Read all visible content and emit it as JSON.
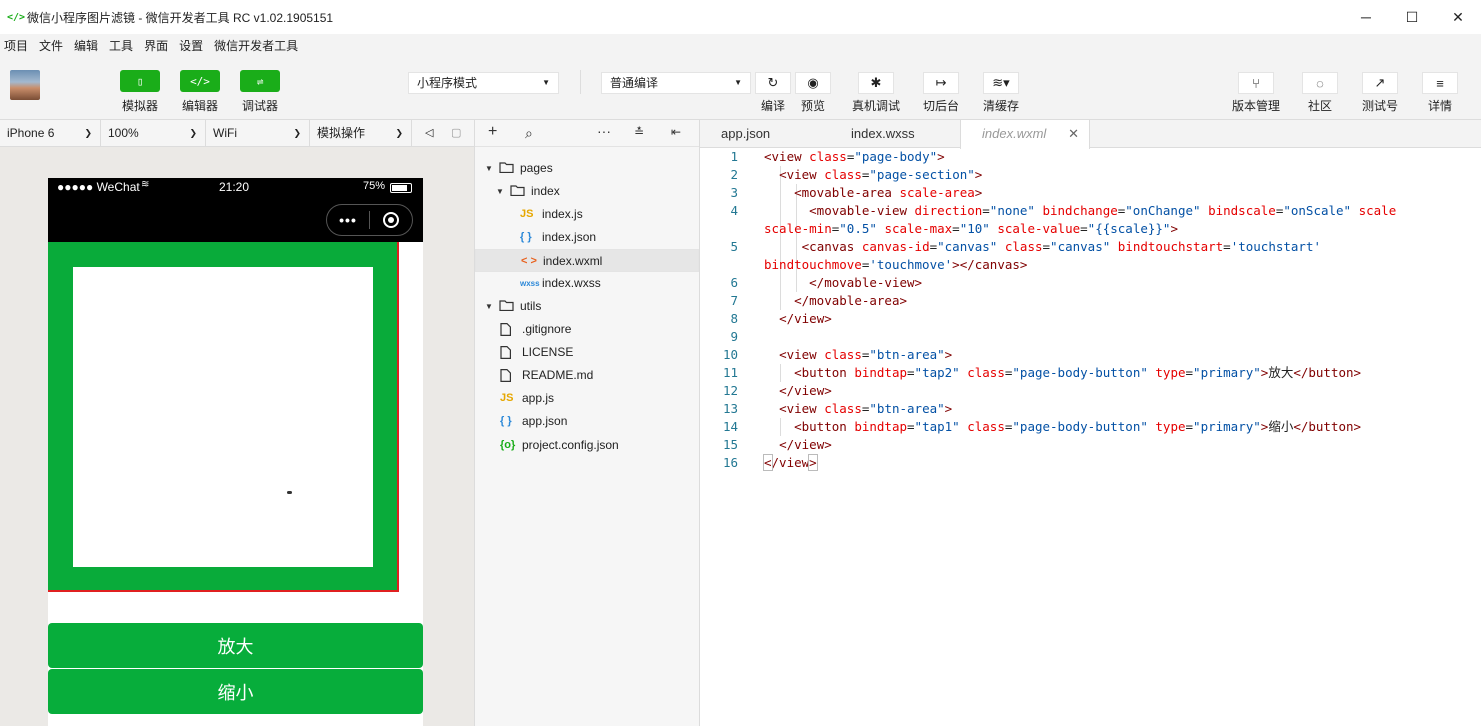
{
  "window": {
    "title": "微信小程序图片滤镜 - 微信开发者工具 RC v1.02.1905151",
    "minimize": "─",
    "maximize": "☐",
    "close": "✕"
  },
  "menu": [
    "项目",
    "文件",
    "编辑",
    "工具",
    "界面",
    "设置",
    "微信开发者工具"
  ],
  "toolbar": {
    "simulator": "模拟器",
    "editor": "编辑器",
    "debugger": "调试器",
    "mode_select": "小程序模式",
    "compile_select": "普通编译",
    "compile": "编译",
    "preview": "预览",
    "remote_debug": "真机调试",
    "background": "切后台",
    "clear_cache": "清缓存",
    "version": "版本管理",
    "community": "社区",
    "test_account": "测试号",
    "details": "详情"
  },
  "simulator": {
    "device": "iPhone 6",
    "zoom": "100%",
    "network": "WiFi",
    "operation": "模拟操作",
    "status_left": "●●●●● WeChat",
    "status_time": "21:20",
    "status_battery": "75%",
    "button_zoom_in": "放大",
    "button_zoom_out": "缩小"
  },
  "explorer": {
    "items": [
      {
        "label": "pages",
        "kind": "folder",
        "icon": "folder-icon"
      },
      {
        "label": "index",
        "kind": "folder",
        "icon": "folder-icon"
      },
      {
        "label": "index.js",
        "kind": "js",
        "icon": "JS"
      },
      {
        "label": "index.json",
        "kind": "json",
        "icon": "{ }"
      },
      {
        "label": "index.wxml",
        "kind": "wxml",
        "icon": "< >"
      },
      {
        "label": "index.wxss",
        "kind": "wxss",
        "icon": "wxss"
      },
      {
        "label": "utils",
        "kind": "folder",
        "icon": "folder-icon"
      },
      {
        "label": ".gitignore",
        "kind": "file",
        "icon": "file-icon"
      },
      {
        "label": "LICENSE",
        "kind": "file",
        "icon": "file-icon"
      },
      {
        "label": "README.md",
        "kind": "file",
        "icon": "file-icon"
      },
      {
        "label": "app.js",
        "kind": "js",
        "icon": "JS"
      },
      {
        "label": "app.json",
        "kind": "json",
        "icon": "{ }"
      },
      {
        "label": "project.config.json",
        "kind": "config",
        "icon": "{o}"
      }
    ]
  },
  "editor": {
    "tabs": [
      "app.json",
      "index.wxss",
      "index.wxml"
    ],
    "active_tab": "index.wxml",
    "line_numbers": [
      "1",
      "2",
      "3",
      "4",
      "5",
      "6",
      "7",
      "8",
      "9",
      "10",
      "11",
      "12",
      "13",
      "14",
      "15",
      "16"
    ]
  },
  "colors": {
    "accent": "#1aad19",
    "phone_green": "#09ab3a",
    "border_red": "#e02020",
    "code_tag": "#800000",
    "code_attr": "#e50000",
    "code_value": "#0451a5"
  }
}
